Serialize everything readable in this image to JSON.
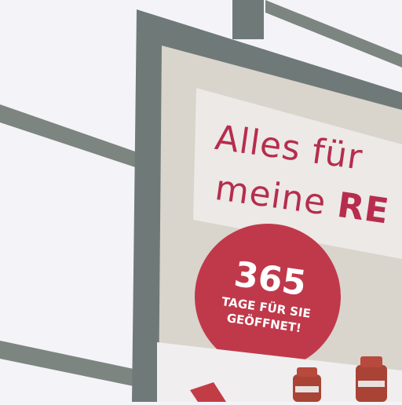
{
  "billboard": {
    "headline_line1": "Alles für",
    "headline_line2_regular": "meine ",
    "headline_line2_bold": "RE",
    "badge_number": "365",
    "badge_line1": "TAGE FÜR SIE",
    "badge_line2": "GEÖFFNET!"
  },
  "colors": {
    "sky": "#f4f4f8",
    "frame": "#6f7a78",
    "poster_background": "#d9d4cc",
    "headline_panel": "#ece9e6",
    "headline_text": "#b62d4d",
    "badge": "#c0394b",
    "badge_text": "#ffffff",
    "bottle": "#a94336"
  }
}
